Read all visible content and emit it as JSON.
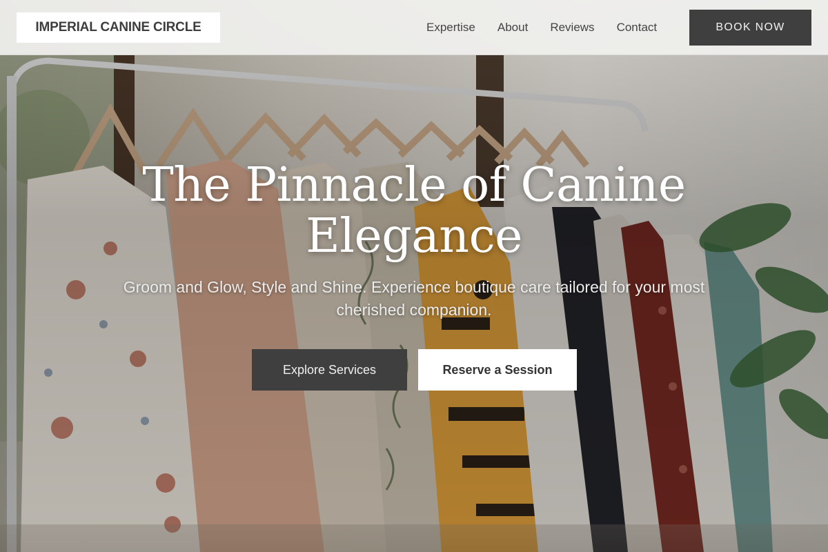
{
  "header": {
    "brand": "IMPERIAL CANINE CIRCLE",
    "nav": [
      "Expertise",
      "About",
      "Reviews",
      "Contact"
    ],
    "cta": "BOOK NOW"
  },
  "hero": {
    "title": "The Pinnacle of Canine Elegance",
    "subtitle": "Groom and Glow, Style and Shine. Experience boutique care tailored for your most cherished companion.",
    "primary_button": "Explore Services",
    "secondary_button": "Reserve a Session",
    "background_image": "clothing-rack-photo"
  },
  "colors": {
    "header_bg": "#f0f0ee",
    "dark_button": "#3f3f3f",
    "light_button": "#ffffff",
    "hero_text": "#ffffff"
  }
}
